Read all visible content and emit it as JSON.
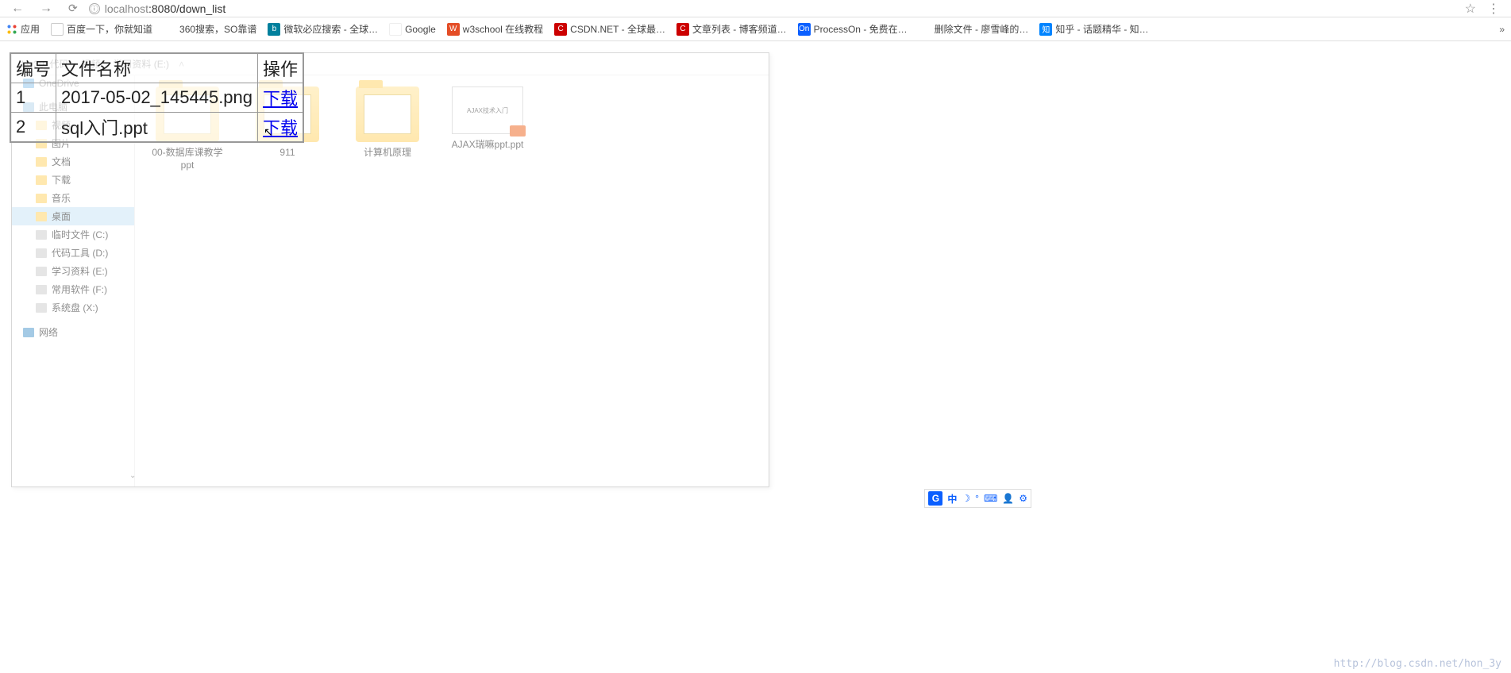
{
  "browser": {
    "url_info_icon": "ⓘ",
    "url_host": "localhost",
    "url_path": ":8080/down_list",
    "back": "←",
    "forward": "→",
    "reload": "⟳",
    "star": "☆",
    "menu": "⋮"
  },
  "bookmarks": {
    "apps_label": "应用",
    "items": [
      {
        "label": "百度一下，你就知道",
        "icon": "百"
      },
      {
        "label": "360搜索，SO靠谱",
        "icon": "○"
      },
      {
        "label": "微软必应搜索 - 全球…",
        "icon": "b"
      },
      {
        "label": "Google",
        "icon": "G"
      },
      {
        "label": "w3school 在线教程",
        "icon": "W"
      },
      {
        "label": "CSDN.NET - 全球最…",
        "icon": "C"
      },
      {
        "label": "文章列表 - 博客频道…",
        "icon": "C"
      },
      {
        "label": "ProcessOn - 免费在…",
        "icon": "On"
      },
      {
        "label": "删除文件 - 廖雪峰的…",
        "icon": "✈"
      },
      {
        "label": "知乎 - 话题精华 - 知…",
        "icon": "知"
      }
    ],
    "overflow": "»"
  },
  "download_table": {
    "headers": {
      "no": "编号",
      "name": "文件名称",
      "action": "操作"
    },
    "rows": [
      {
        "no": "1",
        "name": "2017-05-02_145445.png",
        "action": "下载"
      },
      {
        "no": "2",
        "name": "sql入门.ppt",
        "action": "下载"
      }
    ]
  },
  "explorer": {
    "breadcrumb": [
      "day30_代码",
      "视频",
      "学习资料 (E:)"
    ],
    "side": {
      "onedrive": "OneDrive",
      "thispc": "此电脑",
      "quick": [
        "视频",
        "图片",
        "文档",
        "下载",
        "音乐",
        "桌面"
      ],
      "selected": "桌面",
      "drives": [
        "临时文件 (C:)",
        "代码工具 (D:)",
        "学习资料 (E:)",
        "常用软件 (F:)",
        "系统盘 (X:)"
      ],
      "network": "网络"
    },
    "files": [
      {
        "label": "00-数据库课教学ppt",
        "type": "folder"
      },
      {
        "label": "911",
        "type": "folder"
      },
      {
        "label": "计算机原理",
        "type": "folder"
      },
      {
        "label": "AJAX瑞嘛ppt.ppt",
        "type": "ppt",
        "thumb": "AJAX技术入门"
      }
    ]
  },
  "ime": {
    "main": "G",
    "lang": "中",
    "moon": "☽",
    "punct": "°",
    "keyboard": "⌨",
    "person": "👤",
    "gear": "⚙"
  },
  "watermark": "http://blog.csdn.net/hon_3y"
}
